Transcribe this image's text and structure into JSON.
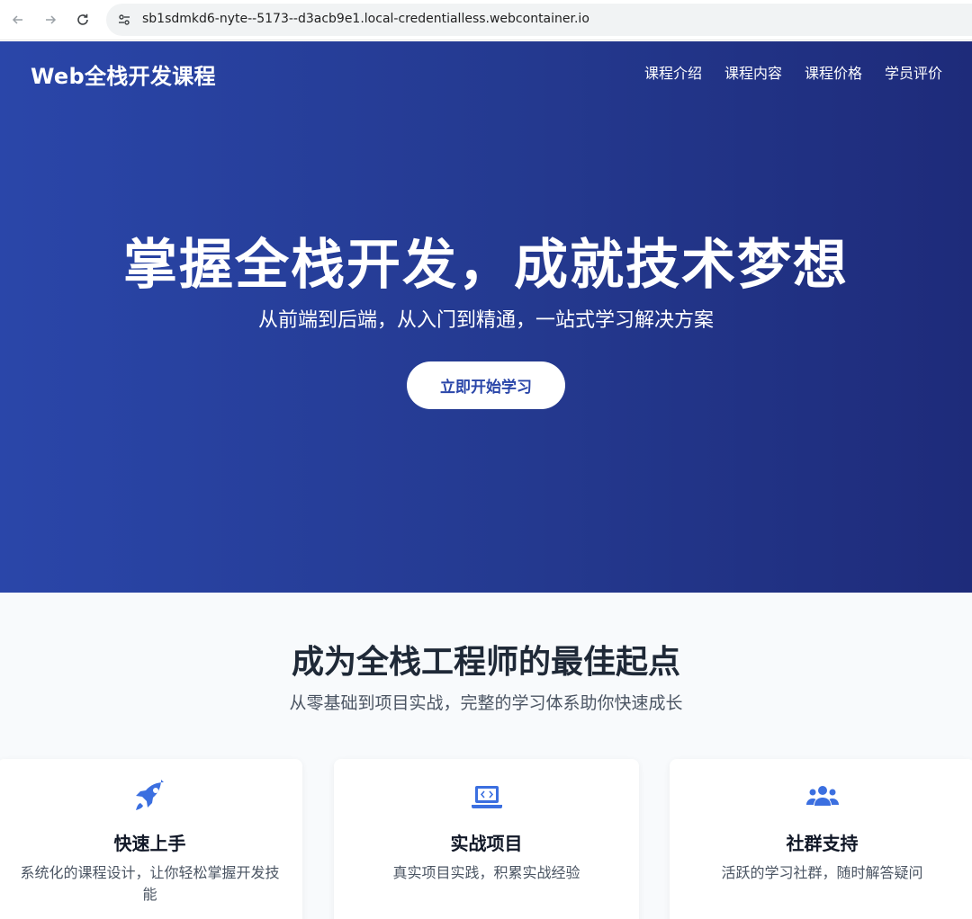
{
  "browser": {
    "url": "sb1sdmkd6-nyte--5173--d3acb9e1.local-credentialless.webcontainer.io"
  },
  "header": {
    "brand": "Web全栈开发课程",
    "nav": [
      "课程介绍",
      "课程内容",
      "课程价格",
      "学员评价"
    ]
  },
  "hero": {
    "title": "掌握全栈开发，成就技术梦想",
    "subtitle": "从前端到后端，从入门到精通，一站式学习解决方案",
    "cta_label": "立即开始学习"
  },
  "features": {
    "title": "成为全栈工程师的最佳起点",
    "subtitle": "从零基础到项目实战，完整的学习体系助你快速成长",
    "cards": [
      {
        "icon": "rocket-icon",
        "title": "快速上手",
        "desc": "系统化的课程设计，让你轻松掌握开发技能"
      },
      {
        "icon": "laptop-code-icon",
        "title": "实战项目",
        "desc": "真实项目实践，积累实战经验"
      },
      {
        "icon": "users-icon",
        "title": "社群支持",
        "desc": "活跃的学习社群，随时解答疑问"
      }
    ]
  },
  "colors": {
    "hero_start": "#2a46a9",
    "hero_end": "#1e2b7a",
    "accent": "#2a46a9",
    "icon_blue": "#3b6fe0",
    "section_bg": "#f8fafc"
  }
}
